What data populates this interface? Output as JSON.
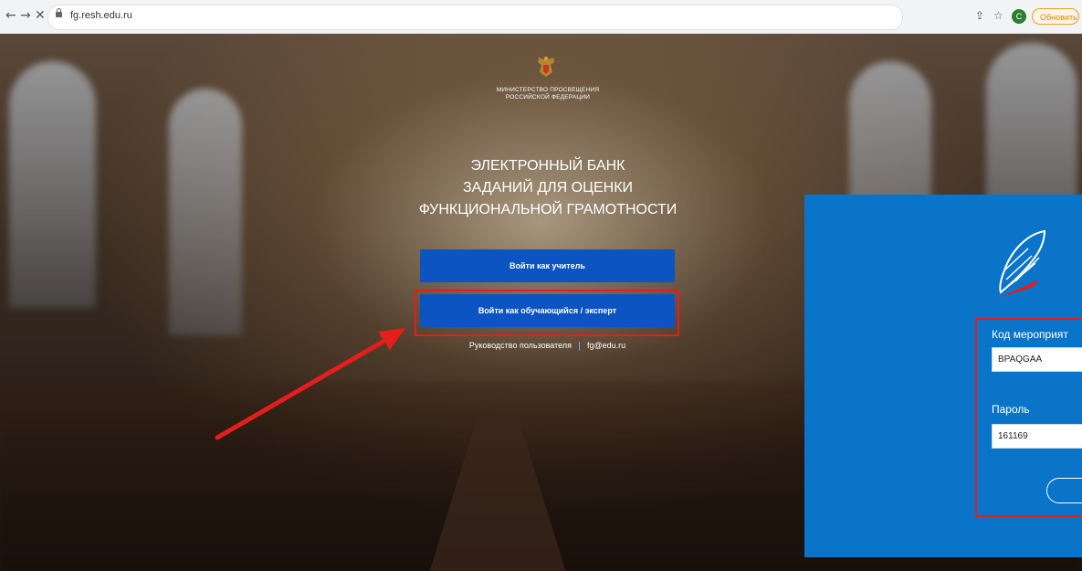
{
  "browser": {
    "url": "fg.resh.edu.ru",
    "update_label": "Обновить",
    "profile_initial": "C"
  },
  "page": {
    "ministry_line1": "МИНИСТЕРСТВО ПРОСВЕЩЕНИЯ",
    "ministry_line2": "РОССИЙСКОЙ ФЕДЕРАЦИИ",
    "title_line1": "ЭЛЕКТРОННЫЙ БАНК",
    "title_line2": "ЗАДАНИЙ ДЛЯ ОЦЕНКИ",
    "title_line3": "ФУНКЦИОНАЛЬНОЙ ГРАМОТНОСТИ",
    "teacher_button": "Войти как учитель",
    "student_button": "Войти как обучающийся / эксперт",
    "guide_link": "Руководство пользователя",
    "email_link": "fg@edu.ru"
  },
  "login_panel": {
    "code_label": "Код мероприят",
    "code_value": "BPAQGAA",
    "password_label": "Пароль",
    "password_value": "161169"
  },
  "colors": {
    "primary_button": "#0b54c2",
    "highlight": "#e51d1d",
    "panel_bg": "#0a74c9"
  }
}
